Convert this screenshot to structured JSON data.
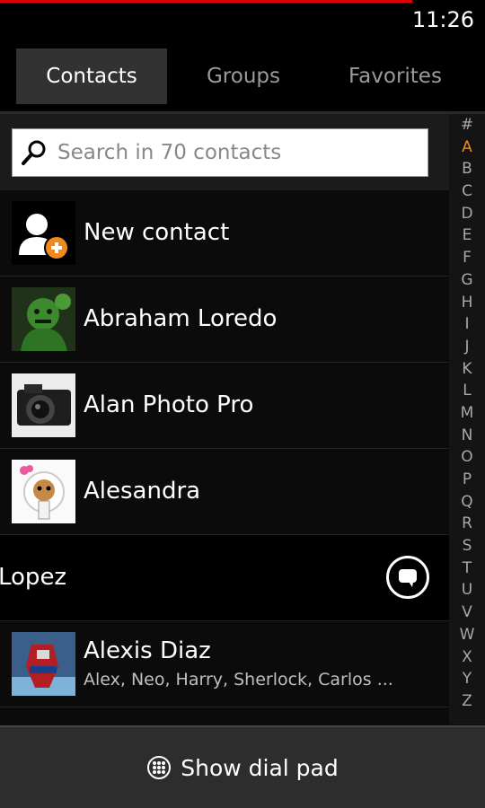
{
  "status": {
    "time": "11:26",
    "progress": 0.85,
    "progress_color": "#e0000a"
  },
  "tabs": [
    {
      "label": "Contacts",
      "active": true
    },
    {
      "label": "Groups",
      "active": false
    },
    {
      "label": "Favorites",
      "active": false
    }
  ],
  "search": {
    "placeholder": "Search in 70 contacts"
  },
  "new_contact": {
    "label": "New contact",
    "icon": "add-person-icon"
  },
  "contacts": [
    {
      "name": "Abraham Loredo",
      "avatar": "hulk-photo"
    },
    {
      "name": "Alan Photo Pro",
      "avatar": "camera-photo"
    },
    {
      "name": "Alesandra",
      "avatar": "cartoon-squirrel-photo"
    },
    {
      "name": "Lopez",
      "avatar": "",
      "swiped": true,
      "action_icon": "message-bubble-icon"
    },
    {
      "name": "Alexis Diaz",
      "avatar": "robot-photo",
      "nicknames": "Alex, Neo, Harry, Sherlock, Carlos ..."
    }
  ],
  "alphabet": [
    "#",
    "A",
    "B",
    "C",
    "D",
    "E",
    "F",
    "G",
    "H",
    "I",
    "J",
    "K",
    "L",
    "M",
    "N",
    "O",
    "P",
    "Q",
    "R",
    "S",
    "T",
    "U",
    "V",
    "W",
    "X",
    "Y",
    "Z"
  ],
  "alphabet_active": "A",
  "accent_color": "#f08a1c",
  "bottom": {
    "label": "Show dial pad",
    "icon": "dial-pad-icon"
  }
}
